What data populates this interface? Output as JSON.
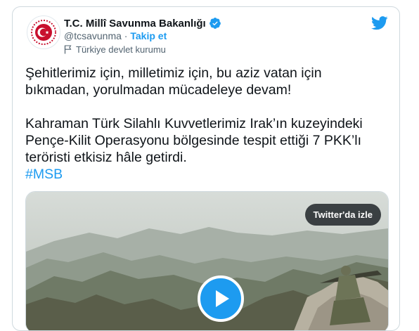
{
  "account": {
    "name": "T.C. Millî Savunma Bakanlığı",
    "handle": "@tcsavunma",
    "separator": " · ",
    "follow_label": "Takip et",
    "label": "Türkiye devlet kurumu"
  },
  "tweet": {
    "line1": "Şehitlerimiz için, milletimiz için, bu aziz vatan için",
    "line2": "bıkmadan, yorulmadan mücadeleye devam!",
    "line3": "Kahraman Türk Silahlı Kuvvetlerimiz Irak’ın kuzeyindeki",
    "line4": "Pençe-Kilit Operasyonu bölgesinde tespit ettiği 7 PKK’lı",
    "line5": "teröristi etkisiz hâle getirdi.",
    "hashtag": "#MSB"
  },
  "media": {
    "watch_label": "Twitter'da izle"
  },
  "colors": {
    "accent": "#1d9bf0",
    "text": "#0f1419",
    "secondary": "#536471",
    "logo_red": "#c8102e"
  },
  "icons": {
    "brand": "twitter-bird-icon",
    "verified": "verified-badge-icon",
    "label": "flag-icon",
    "play": "play-icon"
  }
}
